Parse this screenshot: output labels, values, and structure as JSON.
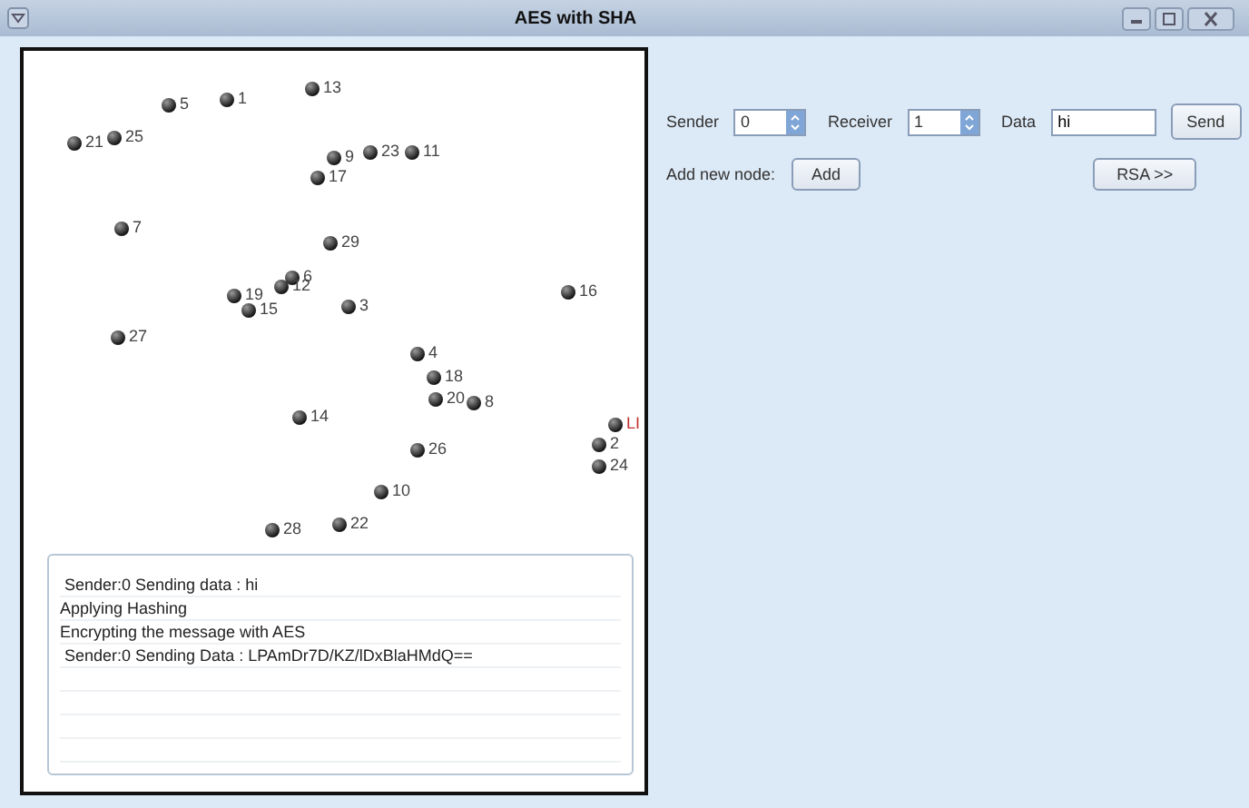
{
  "window": {
    "title": "AES with SHA"
  },
  "nodes": [
    {
      "label": "5",
      "highlighted": false
    },
    {
      "label": "1",
      "highlighted": false
    },
    {
      "label": "13",
      "highlighted": false
    },
    {
      "label": "21",
      "highlighted": false
    },
    {
      "label": "25",
      "highlighted": false
    },
    {
      "label": "9",
      "highlighted": false
    },
    {
      "label": "23",
      "highlighted": false
    },
    {
      "label": "11",
      "highlighted": false
    },
    {
      "label": "17",
      "highlighted": false
    },
    {
      "label": "7",
      "highlighted": false
    },
    {
      "label": "29",
      "highlighted": false
    },
    {
      "label": "6",
      "highlighted": false
    },
    {
      "label": "12",
      "highlighted": false
    },
    {
      "label": "19",
      "highlighted": false
    },
    {
      "label": "15",
      "highlighted": false
    },
    {
      "label": "3",
      "highlighted": false
    },
    {
      "label": "16",
      "highlighted": false
    },
    {
      "label": "27",
      "highlighted": false
    },
    {
      "label": "4",
      "highlighted": false
    },
    {
      "label": "18",
      "highlighted": false
    },
    {
      "label": "20",
      "highlighted": false
    },
    {
      "label": "8",
      "highlighted": false
    },
    {
      "label": "14",
      "highlighted": false
    },
    {
      "label": "26",
      "highlighted": false
    },
    {
      "label": "LI",
      "highlighted": true
    },
    {
      "label": "2",
      "highlighted": false
    },
    {
      "label": "24",
      "highlighted": false
    },
    {
      "label": "10",
      "highlighted": false
    },
    {
      "label": "28",
      "highlighted": false
    },
    {
      "label": "22",
      "highlighted": false
    }
  ],
  "log": {
    "lines": [
      " Sender:0 Sending data : hi",
      "Applying Hashing",
      "Encrypting the message with AES",
      " Sender:0 Sending Data : LPAmDr7D/KZ/lDxBlaHMdQ=="
    ]
  },
  "controls": {
    "sender_label": "Sender",
    "sender_value": "0",
    "receiver_label": "Receiver",
    "receiver_value": "1",
    "data_label": "Data",
    "data_value": "hi",
    "send_button": "Send",
    "add_label": "Add new node:",
    "add_button": "Add",
    "rsa_button": "RSA >>"
  }
}
